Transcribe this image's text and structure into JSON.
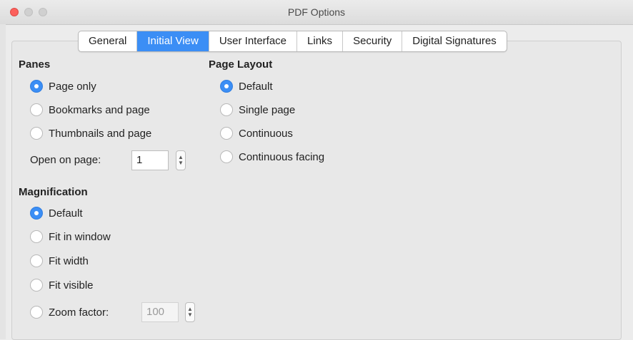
{
  "window": {
    "title": "PDF Options"
  },
  "tabs": [
    {
      "label": "General",
      "active": false
    },
    {
      "label": "Initial View",
      "active": true
    },
    {
      "label": "User Interface",
      "active": false
    },
    {
      "label": "Links",
      "active": false
    },
    {
      "label": "Security",
      "active": false
    },
    {
      "label": "Digital Signatures",
      "active": false
    }
  ],
  "panes": {
    "heading": "Panes",
    "options": [
      {
        "label": "Page only",
        "selected": true
      },
      {
        "label": "Bookmarks and page",
        "selected": false
      },
      {
        "label": "Thumbnails and page",
        "selected": false
      }
    ],
    "open_on_page_label": "Open on page:",
    "open_on_page_value": "1"
  },
  "page_layout": {
    "heading": "Page Layout",
    "options": [
      {
        "label": "Default",
        "selected": true
      },
      {
        "label": "Single page",
        "selected": false
      },
      {
        "label": "Continuous",
        "selected": false
      },
      {
        "label": "Continuous facing",
        "selected": false
      }
    ]
  },
  "magnification": {
    "heading": "Magnification",
    "options": [
      {
        "label": "Default",
        "selected": true
      },
      {
        "label": "Fit in window",
        "selected": false
      },
      {
        "label": "Fit width",
        "selected": false
      },
      {
        "label": "Fit visible",
        "selected": false
      },
      {
        "label": "Zoom factor:",
        "selected": false
      }
    ],
    "zoom_value": "100"
  },
  "colors": {
    "accent": "#3b8ef5"
  }
}
